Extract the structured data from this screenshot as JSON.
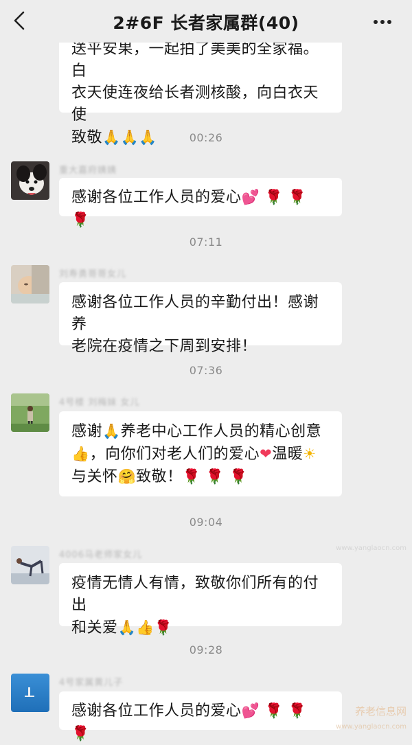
{
  "header": {
    "title": "2#6F   长者家属群(40)"
  },
  "messages": [
    {
      "id": "m0",
      "lines": [
        "送平安果，一起拍了美美的全家福。白",
        "衣天使连夜给长者测核酸，向白衣天使",
        "致敬"
      ],
      "emoji": [
        "folded-hands",
        "folded-hands",
        "folded-hands"
      ]
    },
    {
      "id": "m1",
      "time": "00:26",
      "sender": "重大嘉府姨姨",
      "avatar": "dog-avatar",
      "text": "感谢各位工作人员的爱心",
      "emoji": [
        "heart",
        "rose",
        "rose",
        "rose"
      ]
    },
    {
      "id": "m2",
      "time": "07:11",
      "sender": "刘寿勇哥哥女儿",
      "avatar": "baby-avatar",
      "lines": [
        "感谢各位工作人员的辛勤付出！感谢养",
        "老院在疫情之下周到安排！"
      ]
    },
    {
      "id": "m3",
      "time": "07:36",
      "sender": "4号楼 刘梅妹 女儿",
      "avatar": "outdoor-avatar",
      "line1a": "感谢",
      "line1b": "养老中心工作人员的精心创意",
      "line2a": "，向你们对老人们的爱心",
      "line2b": "温暖",
      "line3a": "与关怀",
      "line3b": "致敬！"
    },
    {
      "id": "m4",
      "time": "09:04",
      "sender": "4006马老师家女儿",
      "avatar": "yoga-avatar",
      "lines": [
        "疫情无情人有情，致敬你们所有的付出",
        "和关爱"
      ]
    },
    {
      "id": "m5",
      "time": "09:28",
      "sender": "4号家属黄儿子",
      "avatar": "sea-avatar",
      "text": "感谢各位工作人员的爱心",
      "emoji": [
        "heart",
        "rose",
        "rose",
        "rose"
      ]
    }
  ],
  "glyphs": {
    "heart": "💕",
    "rose": "🌹",
    "folded_hands": "🙏",
    "thumbs_up": "👍",
    "red_heart": "❤",
    "sun": "☀",
    "hug": "🤗"
  },
  "watermark": {
    "cn": "养老信息网",
    "url": "www.yanglaocn.com"
  }
}
